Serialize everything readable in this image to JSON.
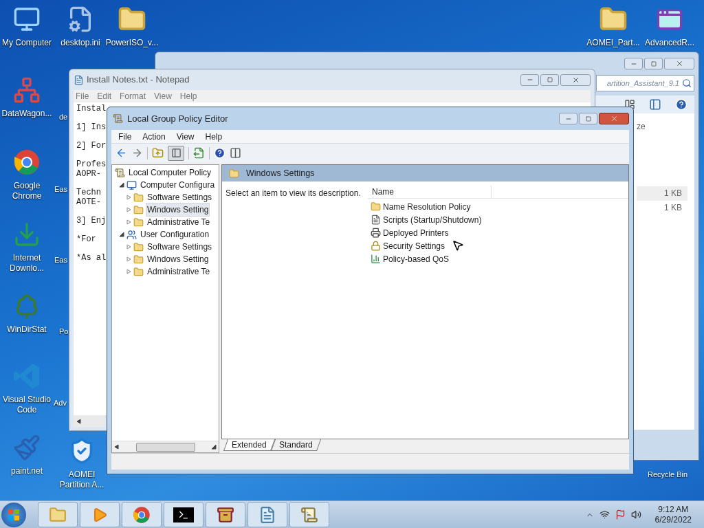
{
  "desktop_icons": [
    {
      "label": "My Computer",
      "kind": "computer"
    },
    {
      "label": "desktop.ini",
      "kind": "settings_file"
    },
    {
      "label": "PowerISO_v...",
      "kind": "folder"
    },
    {
      "label": "DataWagon...",
      "kind": "network"
    },
    {
      "label": "de",
      "kind": "partial"
    },
    {
      "label": "Google Chrome",
      "kind": "browser"
    },
    {
      "label": "Eas",
      "kind": "partial"
    },
    {
      "label": "Internet Downlo...",
      "kind": "download"
    },
    {
      "label": "Eas",
      "kind": "partial"
    },
    {
      "label": "WinDirStat",
      "kind": "tree"
    },
    {
      "label": "Po",
      "kind": "partial"
    },
    {
      "label": "Visual Studio Code",
      "kind": "code"
    },
    {
      "label": "Adv",
      "kind": "partial"
    },
    {
      "label": "paint.net",
      "kind": "paint"
    },
    {
      "label": "AOMEI Partition A...",
      "kind": "shield"
    },
    {
      "label": "AOMEI_Part...",
      "kind": "folder"
    },
    {
      "label": "AdvancedR...",
      "kind": "app"
    },
    {
      "label": "Recycle Bin",
      "kind": "label_only"
    }
  ],
  "explorer": {
    "search": "artition_Assistant_9.1",
    "column_header": "ze",
    "sizes": [
      "1 KB",
      "1 KB"
    ]
  },
  "notepad": {
    "title": "Install Notes.txt - Notepad",
    "menu": [
      "File",
      "Edit",
      "Format",
      "View",
      "Help"
    ],
    "paragraphs": [
      [
        "Instal"
      ],
      [
        "1] Ins"
      ],
      [
        "2] For"
      ],
      [
        "Profes",
        "AOPR-"
      ],
      [
        "Techn",
        "AOTE-"
      ],
      [
        "3] Enj"
      ],
      [
        "*For"
      ],
      [
        "*As al"
      ]
    ]
  },
  "gpe": {
    "title": "Local Group Policy Editor",
    "menu": [
      "File",
      "Action",
      "View",
      "Help"
    ],
    "tree": [
      {
        "label": "Local Computer Policy",
        "kind": "policy",
        "selected": false,
        "children": [
          {
            "label": "Computer Configura",
            "kind": "computer",
            "expanded": true,
            "selected": false,
            "children": [
              {
                "label": "Software Settings",
                "kind": "folder",
                "expanded": false,
                "selected": false
              },
              {
                "label": "Windows Setting",
                "kind": "folder",
                "expanded": false,
                "selected": true
              },
              {
                "label": "Administrative Te",
                "kind": "folder",
                "expanded": false,
                "selected": false
              }
            ]
          },
          {
            "label": "User Configuration",
            "kind": "users",
            "expanded": true,
            "selected": false,
            "children": [
              {
                "label": "Software Settings",
                "kind": "folder",
                "expanded": false,
                "selected": false
              },
              {
                "label": "Windows Setting",
                "kind": "folder",
                "expanded": false,
                "selected": false
              },
              {
                "label": "Administrative Te",
                "kind": "folder",
                "expanded": false,
                "selected": false
              }
            ]
          }
        ]
      }
    ],
    "header": "Windows Settings",
    "description": "Select an item to view its description.",
    "column": "Name",
    "items": [
      {
        "label": "Name Resolution Policy",
        "kind": "folder"
      },
      {
        "label": "Scripts (Startup/Shutdown)",
        "kind": "script"
      },
      {
        "label": "Deployed Printers",
        "kind": "printer"
      },
      {
        "label": "Security Settings",
        "kind": "security"
      },
      {
        "label": "Policy-based QoS",
        "kind": "chart"
      }
    ],
    "tabs": [
      {
        "label": "Extended",
        "selected": true
      },
      {
        "label": "Standard",
        "selected": false
      }
    ]
  },
  "taskbar": {
    "apps": [
      {
        "kind": "explorer"
      },
      {
        "kind": "media"
      },
      {
        "kind": "browser"
      },
      {
        "kind": "terminal"
      },
      {
        "kind": "archive"
      },
      {
        "kind": "notepad"
      },
      {
        "kind": "policy"
      }
    ],
    "time": "9:12 AM",
    "date": "6/29/2022"
  }
}
